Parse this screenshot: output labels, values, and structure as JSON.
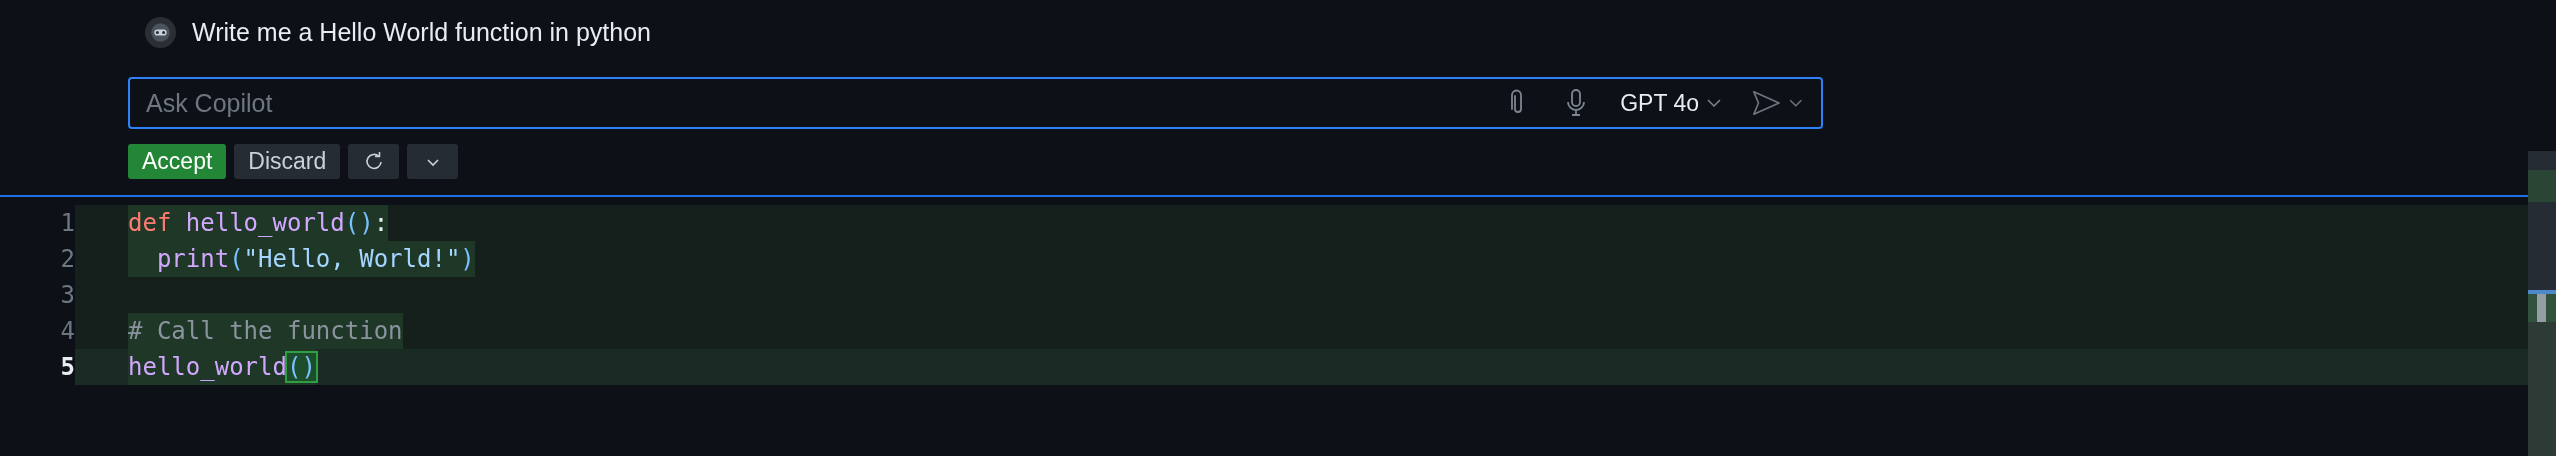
{
  "chat": {
    "prompt": "Write me a Hello World function in python"
  },
  "input": {
    "placeholder": "Ask Copilot",
    "model": "GPT 4o"
  },
  "actions": [
    {
      "label": "Accept",
      "kind": "primary"
    },
    {
      "label": "Discard",
      "kind": "secondary"
    }
  ],
  "editor": {
    "lines": [
      {
        "number": "1",
        "current": false,
        "tokens": [
          {
            "text": "def",
            "kind": "keyword"
          },
          {
            "text": " hello_world",
            "kind": "function"
          },
          {
            "text": "()",
            "kind": "bracket"
          },
          {
            "text": ":",
            "kind": "plain"
          }
        ]
      },
      {
        "number": "2",
        "current": false,
        "tokens": [
          {
            "text": "  print",
            "kind": "function"
          },
          {
            "text": "(",
            "kind": "bracket"
          },
          {
            "text": "\"Hello, World!\"",
            "kind": "string"
          },
          {
            "text": ")",
            "kind": "bracket"
          }
        ]
      },
      {
        "number": "3",
        "current": false
      },
      {
        "number": "4",
        "current": false,
        "tokens": [
          {
            "text": "# Call the function",
            "kind": "comment"
          }
        ]
      },
      {
        "number": "5",
        "current": true,
        "tokens": [
          {
            "text": "hello_world",
            "kind": "function"
          },
          {
            "text": "()",
            "kind": "matched-bracket"
          }
        ]
      }
    ]
  }
}
